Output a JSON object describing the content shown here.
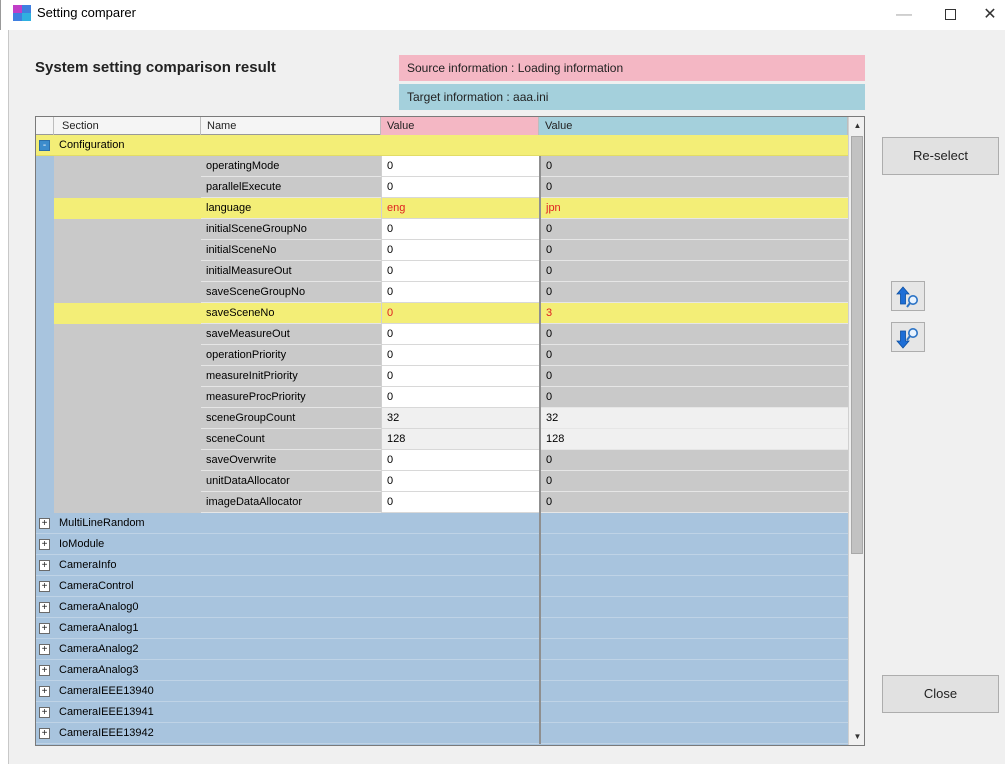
{
  "window": {
    "title": "Setting comparer",
    "minimize_glyph": "—",
    "close_glyph": "✕"
  },
  "header": {
    "title": "System setting comparison result",
    "source_info": "Source information : Loading information",
    "target_info": "Target information : aaa.ini"
  },
  "grid": {
    "columns": {
      "section": "Section",
      "name": "Name",
      "value_source": "Value",
      "value_target": "Value"
    },
    "expanded_section": {
      "label": "Configuration",
      "toggle": "-",
      "items": [
        {
          "name": "operatingMode",
          "source": "0",
          "target": "0",
          "diff": false
        },
        {
          "name": "parallelExecute",
          "source": "0",
          "target": "0",
          "diff": false
        },
        {
          "name": "language",
          "source": "eng",
          "target": "jpn",
          "diff": true
        },
        {
          "name": "initialSceneGroupNo",
          "source": "0",
          "target": "0",
          "diff": false
        },
        {
          "name": "initialSceneNo",
          "source": "0",
          "target": "0",
          "diff": false
        },
        {
          "name": "initialMeasureOut",
          "source": "0",
          "target": "0",
          "diff": false
        },
        {
          "name": "saveSceneGroupNo",
          "source": "0",
          "target": "0",
          "diff": false
        },
        {
          "name": "saveSceneNo",
          "source": "0",
          "target": "3",
          "diff": true
        },
        {
          "name": "saveMeasureOut",
          "source": "0",
          "target": "0",
          "diff": false
        },
        {
          "name": "operationPriority",
          "source": "0",
          "target": "0",
          "diff": false
        },
        {
          "name": "measureInitPriority",
          "source": "0",
          "target": "0",
          "diff": false
        },
        {
          "name": "measureProcPriority",
          "source": "0",
          "target": "0",
          "diff": false
        },
        {
          "name": "sceneGroupCount",
          "source": "32",
          "target": "32",
          "diff": false,
          "plain": true
        },
        {
          "name": "sceneCount",
          "source": "128",
          "target": "128",
          "diff": false,
          "plain": true
        },
        {
          "name": "saveOverwrite",
          "source": "0",
          "target": "0",
          "diff": false
        },
        {
          "name": "unitDataAllocator",
          "source": "0",
          "target": "0",
          "diff": false
        },
        {
          "name": "imageDataAllocator",
          "source": "0",
          "target": "0",
          "diff": false
        }
      ]
    },
    "collapsed_sections": [
      {
        "label": "MultiLineRandom",
        "toggle": "+"
      },
      {
        "label": "IoModule",
        "toggle": "+"
      },
      {
        "label": "CameraInfo",
        "toggle": "+"
      },
      {
        "label": "CameraControl",
        "toggle": "+"
      },
      {
        "label": "CameraAnalog0",
        "toggle": "+"
      },
      {
        "label": "CameraAnalog1",
        "toggle": "+"
      },
      {
        "label": "CameraAnalog2",
        "toggle": "+"
      },
      {
        "label": "CameraAnalog3",
        "toggle": "+"
      },
      {
        "label": "CameraIEEE13940",
        "toggle": "+"
      },
      {
        "label": "CameraIEEE13941",
        "toggle": "+"
      },
      {
        "label": "CameraIEEE13942",
        "toggle": "+"
      }
    ]
  },
  "buttons": {
    "reselect": "Re-select",
    "close": "Close",
    "previous_diff_icon": "arrow-up-search-icon",
    "next_diff_icon": "arrow-down-search-icon"
  },
  "colors": {
    "source": "#f4b7c4",
    "target": "#a4d0dc",
    "diff_highlight": "#f3ee77",
    "diff_text": "#e02020",
    "section_row": "#a8c4de"
  }
}
